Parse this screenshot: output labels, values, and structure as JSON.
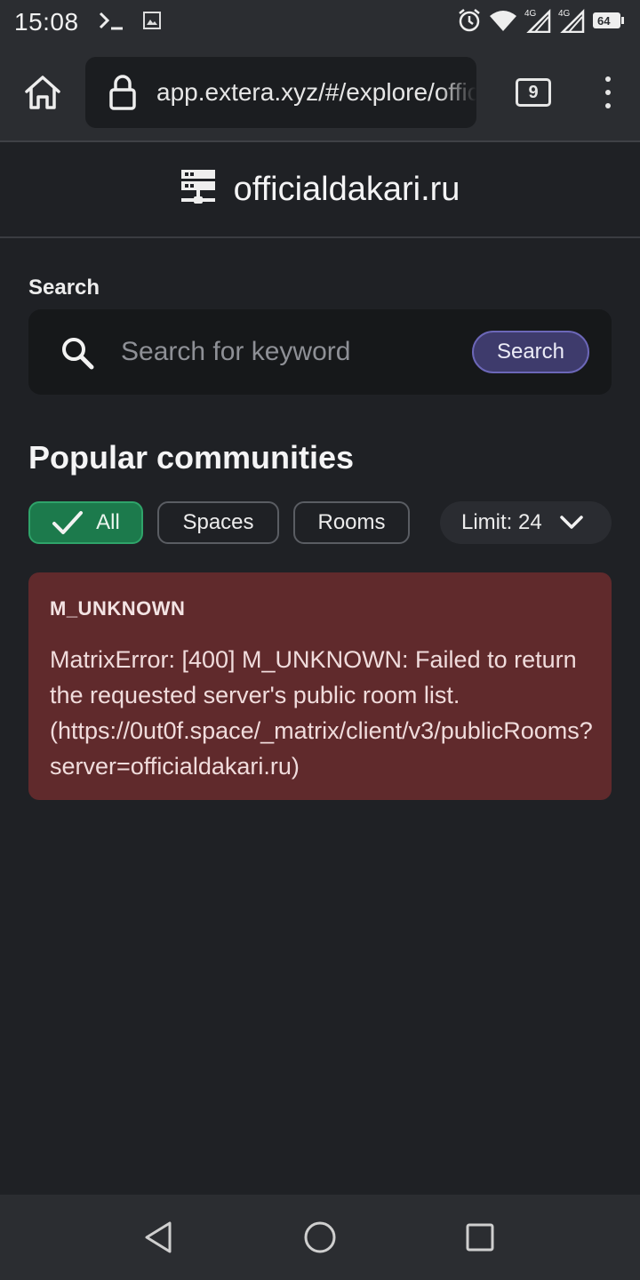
{
  "status_bar": {
    "time": "15:08",
    "battery": "64",
    "icons": [
      "terminal-icon",
      "image-icon",
      "alarm-icon",
      "wifi-icon",
      "signal-4g-icon",
      "signal-4g-icon",
      "battery-icon"
    ],
    "network_label": "4G"
  },
  "browser": {
    "url": "app.extera.xyz/#/explore/officialdakari.ru",
    "tab_count": "9"
  },
  "header": {
    "title": "officialdakari.ru",
    "icon": "server-icon"
  },
  "search": {
    "label": "Search",
    "placeholder": "Search for keyword",
    "value": "",
    "button_label": "Search"
  },
  "communities": {
    "title": "Popular communities",
    "filters": [
      {
        "label": "All",
        "selected": true
      },
      {
        "label": "Spaces",
        "selected": false
      },
      {
        "label": "Rooms",
        "selected": false
      }
    ],
    "limit_label": "Limit: 24"
  },
  "error": {
    "title": "M_UNKNOWN",
    "message": "MatrixError: [400] M_UNKNOWN: Failed to return the requested server's public room list. (https://0ut0f.space/_matrix/client/v3/publicRooms?server=officialdakari.ru)"
  },
  "colors": {
    "background": "#1f2125",
    "accent_green": "#1c7a4c",
    "search_button": "#3e3b6c",
    "error_bg": "#602a2c"
  }
}
